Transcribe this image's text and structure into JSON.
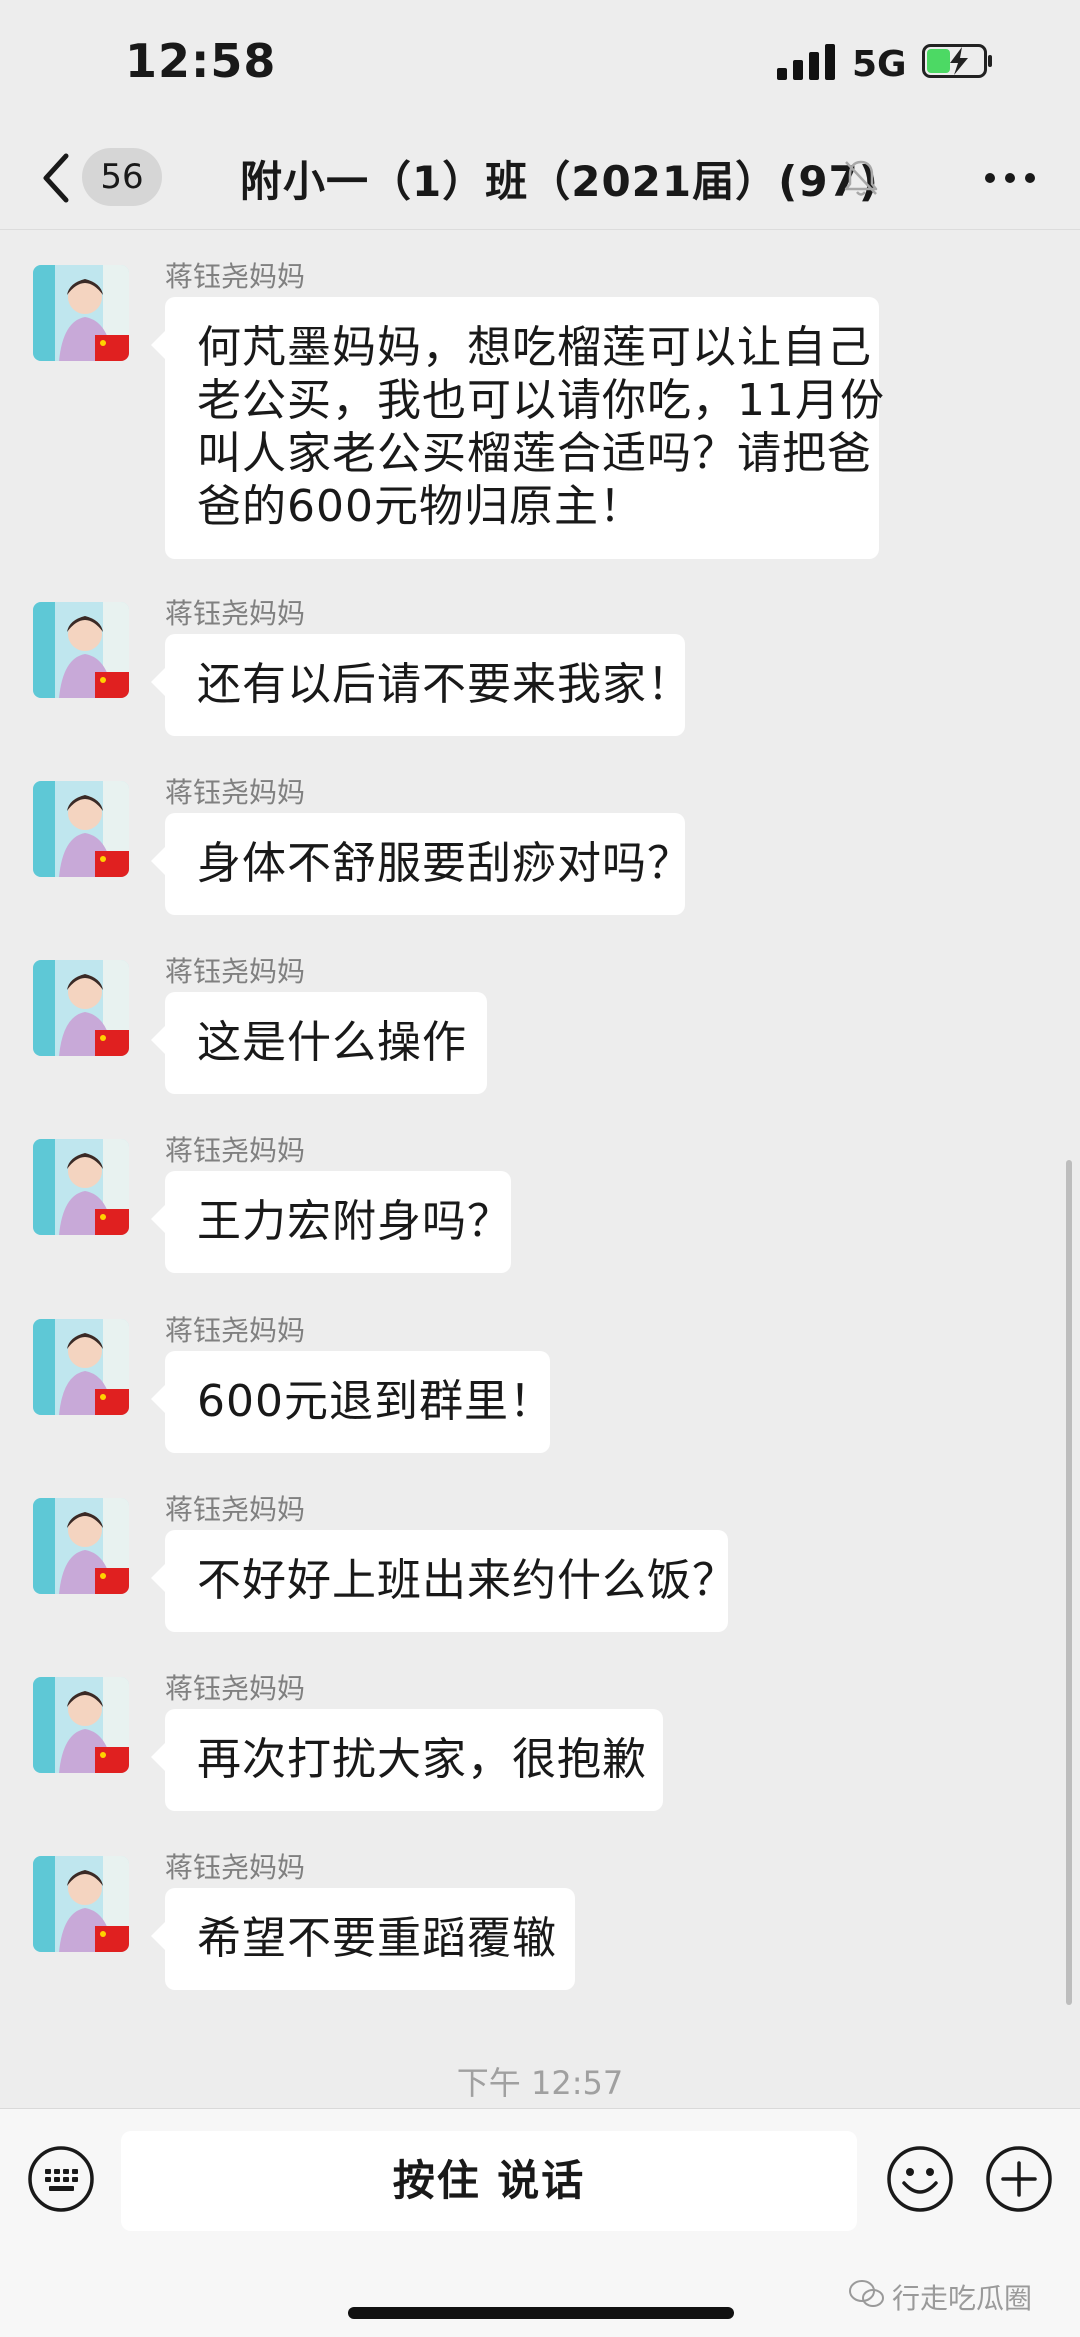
{
  "status_bar": {
    "time": "12:58",
    "network": "5G"
  },
  "nav": {
    "back_badge": "56",
    "title": "附小一（1）班（2021届）(97)"
  },
  "messages": [
    {
      "sender": "蒋钰尧妈妈",
      "lines": [
        "何芃墨妈妈，想吃榴莲可以让自己",
        "老公买，我也可以请你吃，11月份",
        "叫人家老公买榴莲合适吗？请把爸",
        "爸的600元物归原主！"
      ]
    },
    {
      "sender": "蒋钰尧妈妈",
      "lines": [
        "还有以后请不要来我家！"
      ]
    },
    {
      "sender": "蒋钰尧妈妈",
      "lines": [
        "身体不舒服要刮痧对吗？"
      ]
    },
    {
      "sender": "蒋钰尧妈妈",
      "lines": [
        "这是什么操作"
      ]
    },
    {
      "sender": "蒋钰尧妈妈",
      "lines": [
        "王力宏附身吗？"
      ]
    },
    {
      "sender": "蒋钰尧妈妈",
      "lines": [
        "600元退到群里！"
      ]
    },
    {
      "sender": "蒋钰尧妈妈",
      "lines": [
        "不好好上班出来约什么饭？"
      ]
    },
    {
      "sender": "蒋钰尧妈妈",
      "lines": [
        "再次打扰大家，很抱歉"
      ]
    },
    {
      "sender": "蒋钰尧妈妈",
      "lines": [
        "希望不要重蹈覆辙"
      ]
    }
  ],
  "timestamp": "下午 12:57",
  "input_bar": {
    "voice_label": "按住 说话"
  },
  "watermark": "行走吃瓜圈",
  "colors": {
    "background": "#ededed",
    "bubble": "#ffffff",
    "battery_green": "#4cd964",
    "sender_gray": "#808080"
  }
}
